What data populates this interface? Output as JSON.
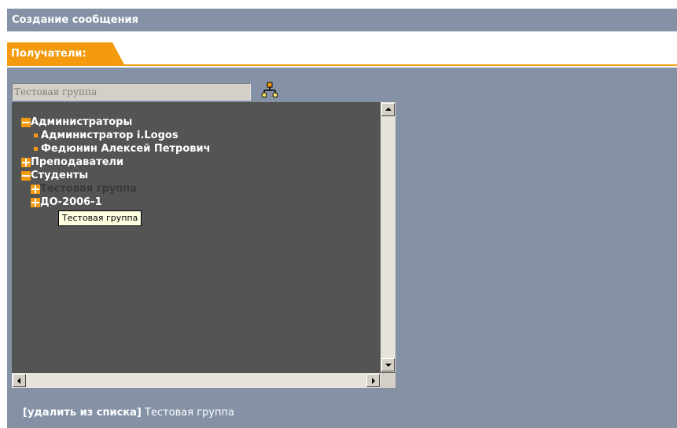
{
  "title": "Создание сообщения",
  "tab": {
    "label": "Получатели:"
  },
  "search": {
    "value": "Тестовая группа"
  },
  "tree": {
    "items": [
      {
        "label": "Администраторы",
        "state": "expanded",
        "children": [
          {
            "label": "Администратор i.Logos"
          },
          {
            "label": "Федюнин Алексей Петрович"
          }
        ]
      },
      {
        "label": "Преподаватели",
        "state": "collapsed"
      },
      {
        "label": "Студенты",
        "state": "expanded",
        "children": [
          {
            "label": "Тестовая группа",
            "state": "collapsed",
            "selected": true
          },
          {
            "label": "ДО-2006-1",
            "state": "collapsed"
          }
        ]
      }
    ]
  },
  "tooltip": "Тестовая группа",
  "footer": {
    "open_bracket": "[",
    "remove_label": "удалить из списка",
    "close_bracket": "]",
    "recipient": "Тестовая группа"
  },
  "colors": {
    "accent": "#f39a0e",
    "panel": "#8592a6",
    "tree_bg": "#545454"
  },
  "icons": {
    "tree_view": "tree-structure-icon"
  }
}
